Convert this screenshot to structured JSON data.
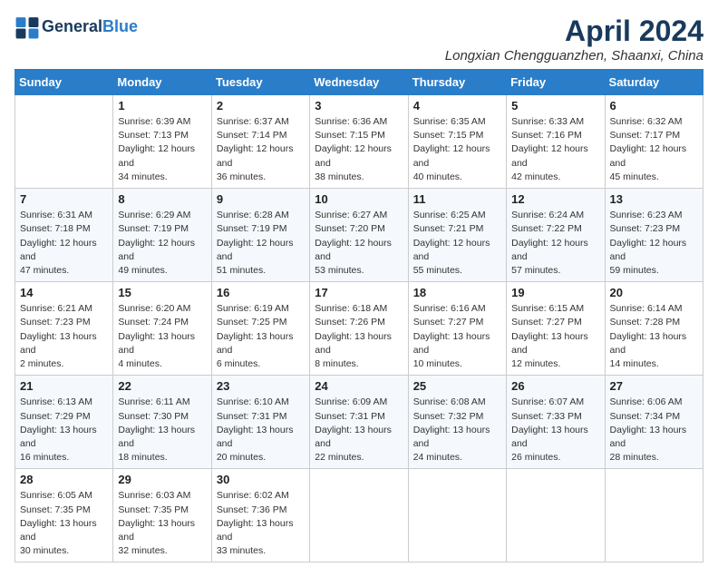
{
  "header": {
    "logo_line1": "General",
    "logo_line2": "Blue",
    "title": "April 2024",
    "location": "Longxian Chengguanzhen, Shaanxi, China"
  },
  "weekdays": [
    "Sunday",
    "Monday",
    "Tuesday",
    "Wednesday",
    "Thursday",
    "Friday",
    "Saturday"
  ],
  "weeks": [
    [
      {
        "day": null
      },
      {
        "day": 1,
        "sunrise": "6:39 AM",
        "sunset": "7:13 PM",
        "daylight": "12 hours and 34 minutes."
      },
      {
        "day": 2,
        "sunrise": "6:37 AM",
        "sunset": "7:14 PM",
        "daylight": "12 hours and 36 minutes."
      },
      {
        "day": 3,
        "sunrise": "6:36 AM",
        "sunset": "7:15 PM",
        "daylight": "12 hours and 38 minutes."
      },
      {
        "day": 4,
        "sunrise": "6:35 AM",
        "sunset": "7:15 PM",
        "daylight": "12 hours and 40 minutes."
      },
      {
        "day": 5,
        "sunrise": "6:33 AM",
        "sunset": "7:16 PM",
        "daylight": "12 hours and 42 minutes."
      },
      {
        "day": 6,
        "sunrise": "6:32 AM",
        "sunset": "7:17 PM",
        "daylight": "12 hours and 45 minutes."
      }
    ],
    [
      {
        "day": 7,
        "sunrise": "6:31 AM",
        "sunset": "7:18 PM",
        "daylight": "12 hours and 47 minutes."
      },
      {
        "day": 8,
        "sunrise": "6:29 AM",
        "sunset": "7:19 PM",
        "daylight": "12 hours and 49 minutes."
      },
      {
        "day": 9,
        "sunrise": "6:28 AM",
        "sunset": "7:19 PM",
        "daylight": "12 hours and 51 minutes."
      },
      {
        "day": 10,
        "sunrise": "6:27 AM",
        "sunset": "7:20 PM",
        "daylight": "12 hours and 53 minutes."
      },
      {
        "day": 11,
        "sunrise": "6:25 AM",
        "sunset": "7:21 PM",
        "daylight": "12 hours and 55 minutes."
      },
      {
        "day": 12,
        "sunrise": "6:24 AM",
        "sunset": "7:22 PM",
        "daylight": "12 hours and 57 minutes."
      },
      {
        "day": 13,
        "sunrise": "6:23 AM",
        "sunset": "7:23 PM",
        "daylight": "12 hours and 59 minutes."
      }
    ],
    [
      {
        "day": 14,
        "sunrise": "6:21 AM",
        "sunset": "7:23 PM",
        "daylight": "13 hours and 2 minutes."
      },
      {
        "day": 15,
        "sunrise": "6:20 AM",
        "sunset": "7:24 PM",
        "daylight": "13 hours and 4 minutes."
      },
      {
        "day": 16,
        "sunrise": "6:19 AM",
        "sunset": "7:25 PM",
        "daylight": "13 hours and 6 minutes."
      },
      {
        "day": 17,
        "sunrise": "6:18 AM",
        "sunset": "7:26 PM",
        "daylight": "13 hours and 8 minutes."
      },
      {
        "day": 18,
        "sunrise": "6:16 AM",
        "sunset": "7:27 PM",
        "daylight": "13 hours and 10 minutes."
      },
      {
        "day": 19,
        "sunrise": "6:15 AM",
        "sunset": "7:27 PM",
        "daylight": "13 hours and 12 minutes."
      },
      {
        "day": 20,
        "sunrise": "6:14 AM",
        "sunset": "7:28 PM",
        "daylight": "13 hours and 14 minutes."
      }
    ],
    [
      {
        "day": 21,
        "sunrise": "6:13 AM",
        "sunset": "7:29 PM",
        "daylight": "13 hours and 16 minutes."
      },
      {
        "day": 22,
        "sunrise": "6:11 AM",
        "sunset": "7:30 PM",
        "daylight": "13 hours and 18 minutes."
      },
      {
        "day": 23,
        "sunrise": "6:10 AM",
        "sunset": "7:31 PM",
        "daylight": "13 hours and 20 minutes."
      },
      {
        "day": 24,
        "sunrise": "6:09 AM",
        "sunset": "7:31 PM",
        "daylight": "13 hours and 22 minutes."
      },
      {
        "day": 25,
        "sunrise": "6:08 AM",
        "sunset": "7:32 PM",
        "daylight": "13 hours and 24 minutes."
      },
      {
        "day": 26,
        "sunrise": "6:07 AM",
        "sunset": "7:33 PM",
        "daylight": "13 hours and 26 minutes."
      },
      {
        "day": 27,
        "sunrise": "6:06 AM",
        "sunset": "7:34 PM",
        "daylight": "13 hours and 28 minutes."
      }
    ],
    [
      {
        "day": 28,
        "sunrise": "6:05 AM",
        "sunset": "7:35 PM",
        "daylight": "13 hours and 30 minutes."
      },
      {
        "day": 29,
        "sunrise": "6:03 AM",
        "sunset": "7:35 PM",
        "daylight": "13 hours and 32 minutes."
      },
      {
        "day": 30,
        "sunrise": "6:02 AM",
        "sunset": "7:36 PM",
        "daylight": "13 hours and 33 minutes."
      },
      {
        "day": null
      },
      {
        "day": null
      },
      {
        "day": null
      },
      {
        "day": null
      }
    ]
  ],
  "labels": {
    "sunrise": "Sunrise:",
    "sunset": "Sunset:",
    "daylight": "Daylight:"
  }
}
